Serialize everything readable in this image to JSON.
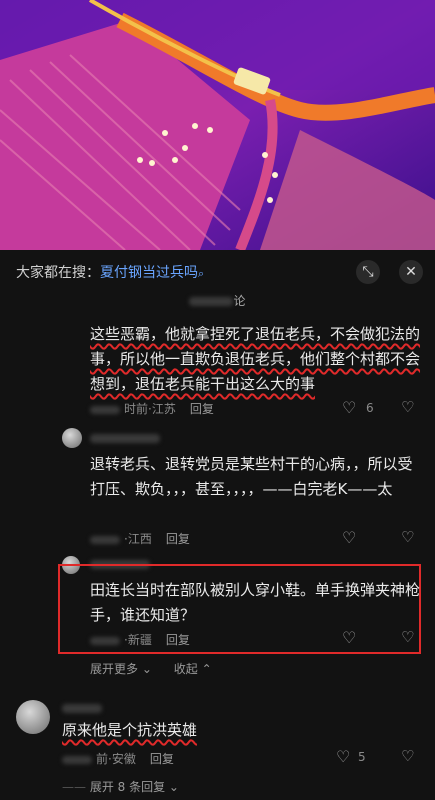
{
  "search": {
    "prefix": "大家都在搜：",
    "term": "夏付钢当过兵吗",
    "search_icon": "search-icon",
    "collapse_icon": "collapse-icon",
    "close_icon": "close-icon"
  },
  "comments_title": "论",
  "comments": [
    {
      "text": "这些恶霸，他就拿捏死了退伍老兵，不会做犯法的事，所以他一直欺负退伍老兵，他们整个村都不会想到，退伍老兵能干出这么大的事",
      "time": "时前",
      "location": "江苏",
      "reply": "回复",
      "likes": "6"
    },
    {
      "text": "退转老兵、退转党员是某些村干的心病，，所以受打压、欺负，，，甚至，，，，——白完老K——太",
      "location": "江西",
      "reply": "回复"
    },
    {
      "text": "田连长当时在部队被别人穿小鞋。单手换弹夹神枪手，谁还知道？",
      "location": "新疆",
      "reply": "回复"
    },
    {
      "text": "原来他是个抗洪英雄",
      "time": "前",
      "location": "安徽",
      "reply": "回复",
      "likes": "5"
    }
  ],
  "thread_controls": {
    "expand_more": "展开更多",
    "collapse": "收起",
    "expand_replies": "展开 8 条回复"
  },
  "colors": {
    "background": "#121212",
    "link": "#6aa5ff",
    "annotation_red": "#e02a2a"
  }
}
